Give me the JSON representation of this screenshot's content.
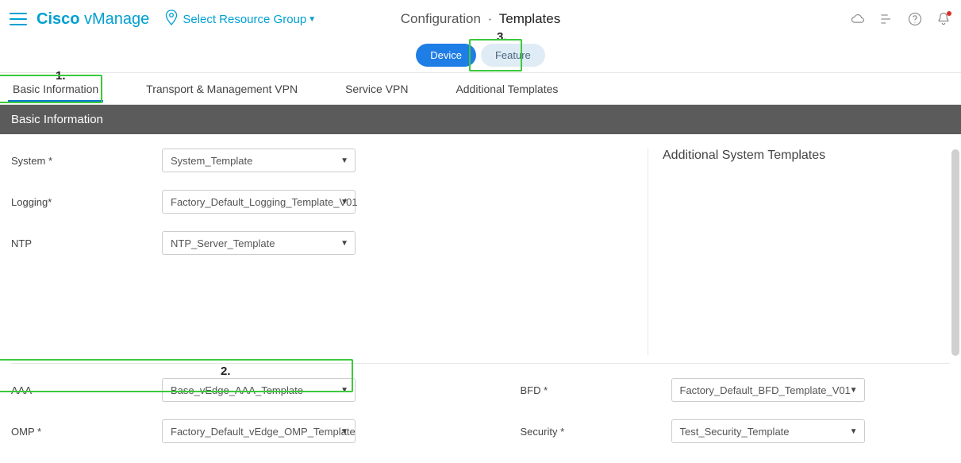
{
  "header": {
    "brand_bold": "Cisco",
    "brand_light": " vManage",
    "resource_group": "Select Resource Group",
    "breadcrumb_parent": "Configuration",
    "breadcrumb_sep": "·",
    "breadcrumb_current": "Templates"
  },
  "annotations": {
    "one": "1.",
    "two": "2.",
    "three": "3."
  },
  "toggle": {
    "device": "Device",
    "feature": "Feature"
  },
  "tabs": {
    "basic": "Basic Information",
    "transport": "Transport & Management VPN",
    "service": "Service VPN",
    "additional": "Additional Templates"
  },
  "section_title": "Basic Information",
  "right_panel_title": "Additional System Templates",
  "form": {
    "system_label": "System *",
    "system_value": "System_Template",
    "logging_label": "Logging*",
    "logging_value": "Factory_Default_Logging_Template_V01",
    "ntp_label": "NTP",
    "ntp_value": "NTP_Server_Template"
  },
  "lower": {
    "aaa_label": "AAA",
    "aaa_value": "Base_vEdge_AAA_Template",
    "omp_label": "OMP *",
    "omp_value": "Factory_Default_vEdge_OMP_Template",
    "bfd_label": "BFD *",
    "bfd_value": "Factory_Default_BFD_Template_V01",
    "security_label": "Security *",
    "security_value": "Test_Security_Template"
  }
}
